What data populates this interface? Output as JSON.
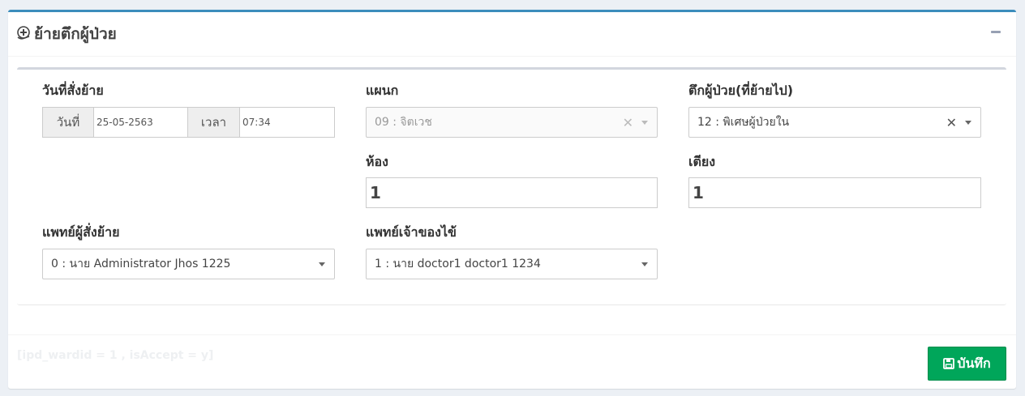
{
  "header": {
    "title": "ย้ายตึกผู้ป่วย",
    "icon": "hand-holding-medical-icon",
    "collapse_icon": "minus-icon"
  },
  "form": {
    "order_date": {
      "label": "วันที่สั่งย้าย",
      "date_addon": "วันที่",
      "date_value": "25-05-2563",
      "time_addon": "เวลา",
      "time_value": "07:34"
    },
    "department": {
      "label": "แผนก",
      "value": "09 : จิตเวช",
      "disabled": true
    },
    "ward_to": {
      "label": "ตึกผู้ป่วย(ที่ย้ายไป)",
      "value": "12 : พิเศษผู้ป่วยใน"
    },
    "room": {
      "label": "ห้อง",
      "value": "1"
    },
    "bed": {
      "label": "เตียง",
      "value": "1"
    },
    "ordering_doctor": {
      "label": "แพทย์ผู้สั่งย้าย",
      "value": "0 : นาย Administrator Jhos 1225"
    },
    "owner_doctor": {
      "label": "แพทย์เจ้าของไข้",
      "value": "1 : นาย doctor1 doctor1 1234"
    }
  },
  "footer": {
    "debug_text": "[ipd_wardid = 1 , isAccept = y]",
    "save_label": "บันทึก",
    "save_icon": "floppy-disk-icon"
  },
  "colors": {
    "accent": "#3c8dbc",
    "save_button": "#00a65a"
  }
}
